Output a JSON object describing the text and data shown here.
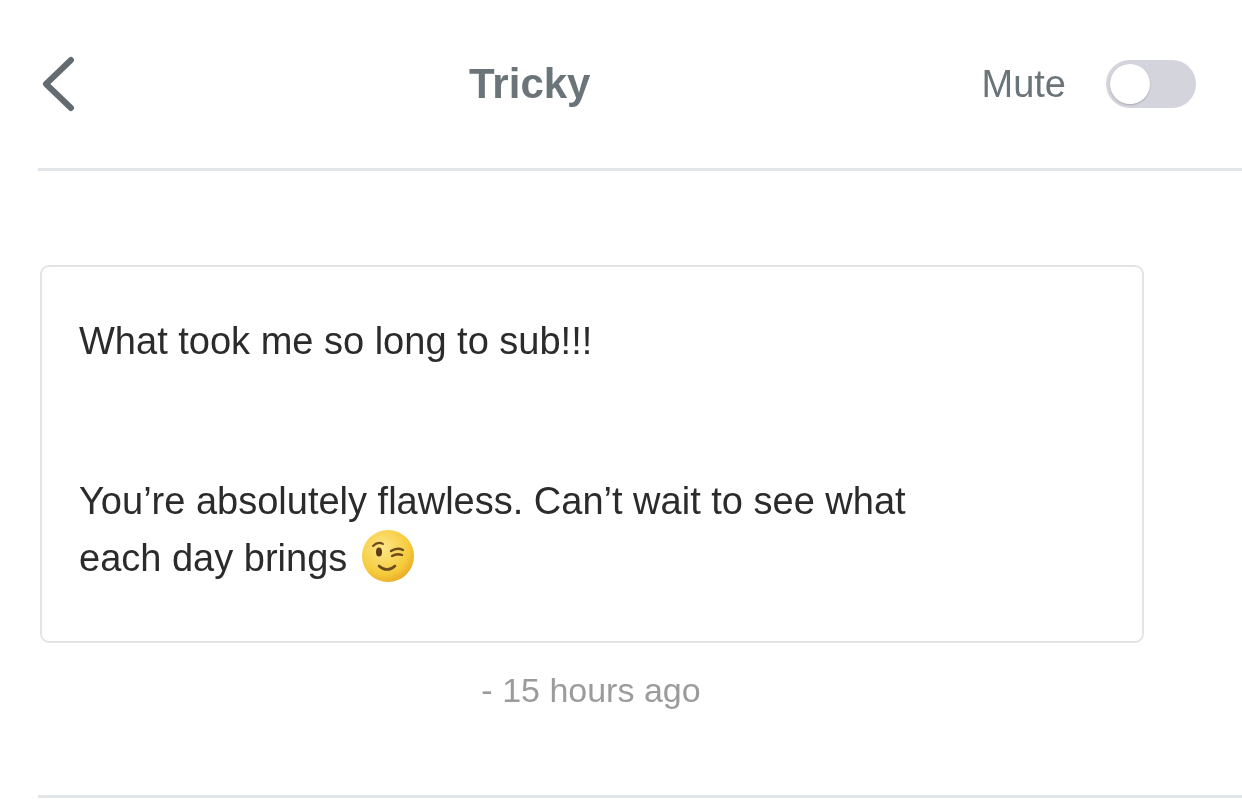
{
  "header": {
    "title": "Tricky",
    "mute": {
      "label": "Mute",
      "on": false
    }
  },
  "message": {
    "paragraphs": [
      {
        "lines": [
          "What took me so long to sub!!!"
        ]
      },
      {
        "lines": [
          "You’re absolutely flawless. Can’t wait to see what",
          "each day brings"
        ]
      }
    ],
    "time": "- 15 hours ago"
  }
}
